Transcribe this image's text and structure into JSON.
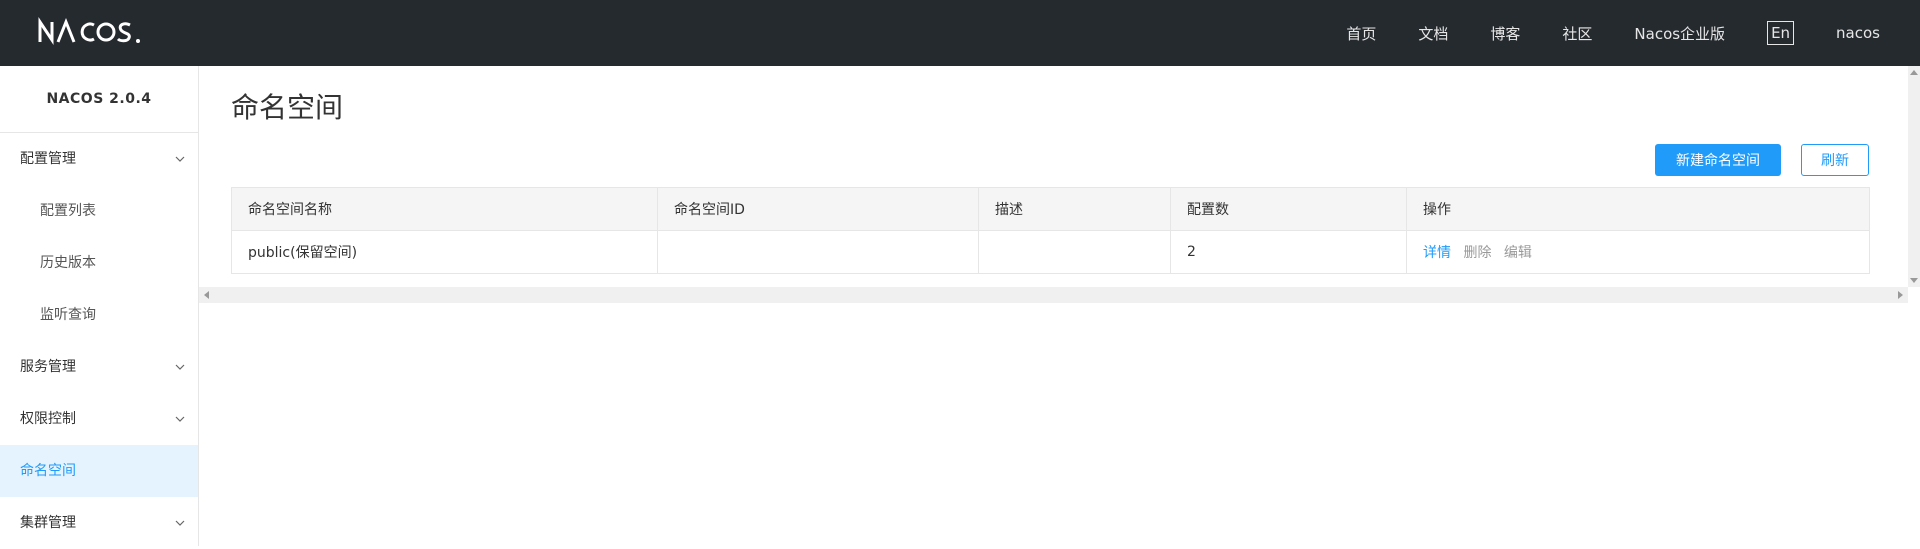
{
  "header": {
    "logo_text": "NACOS.",
    "nav": [
      "首页",
      "文档",
      "博客",
      "社区",
      "Nacos企业版"
    ],
    "lang": "En",
    "user": "nacos"
  },
  "sidebar": {
    "version": "NACOS 2.0.4",
    "items": [
      {
        "label": "配置管理",
        "type": "group"
      },
      {
        "label": "配置列表",
        "type": "sub"
      },
      {
        "label": "历史版本",
        "type": "sub"
      },
      {
        "label": "监听查询",
        "type": "sub"
      },
      {
        "label": "服务管理",
        "type": "group"
      },
      {
        "label": "权限控制",
        "type": "group"
      },
      {
        "label": "命名空间",
        "type": "active"
      },
      {
        "label": "集群管理",
        "type": "group"
      }
    ]
  },
  "main": {
    "title": "命名空间",
    "create_button": "新建命名空间",
    "refresh_button": "刷新",
    "table": {
      "columns": [
        "命名空间名称",
        "命名空间ID",
        "描述",
        "配置数",
        "操作"
      ],
      "rows": [
        {
          "name": "public(保留空间)",
          "id": "",
          "desc": "",
          "count": "2",
          "ops": [
            "详情",
            "删除",
            "编辑"
          ]
        }
      ]
    }
  },
  "colors": {
    "header_bg": "#252a2f",
    "accent": "#209bfa",
    "active_bg": "#e5f3ff"
  }
}
